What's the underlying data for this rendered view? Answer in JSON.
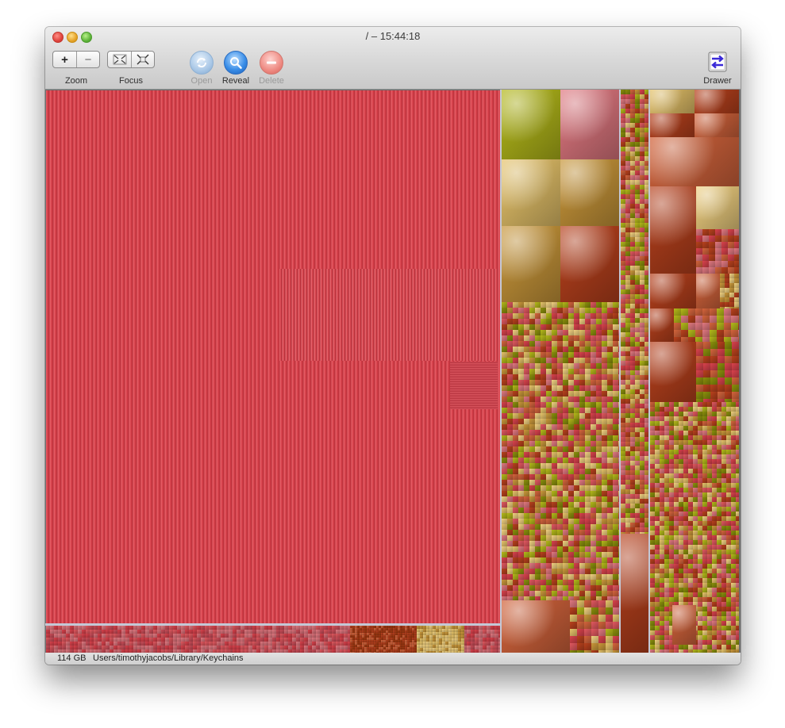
{
  "window": {
    "title": "/ – 15:44:18"
  },
  "toolbar": {
    "zoom": {
      "label": "Zoom",
      "plus": "+",
      "minus": "−"
    },
    "focus": {
      "label": "Focus"
    },
    "open": {
      "label": "Open",
      "enabled": false
    },
    "reveal": {
      "label": "Reveal",
      "enabled": true
    },
    "delete": {
      "label": "Delete",
      "enabled": false
    },
    "drawer": {
      "label": "Drawer"
    }
  },
  "treemap": {
    "palette": [
      "#d8424c",
      "#e0585f",
      "#c9973a",
      "#e6c36a",
      "#8a8f0c",
      "#b3b81a",
      "#b8411d",
      "#d3643c",
      "#e07880",
      "#f0d080"
    ]
  },
  "status": {
    "size": "114 GB",
    "path": "Users/timothyjacobs/Library/Keychains"
  }
}
